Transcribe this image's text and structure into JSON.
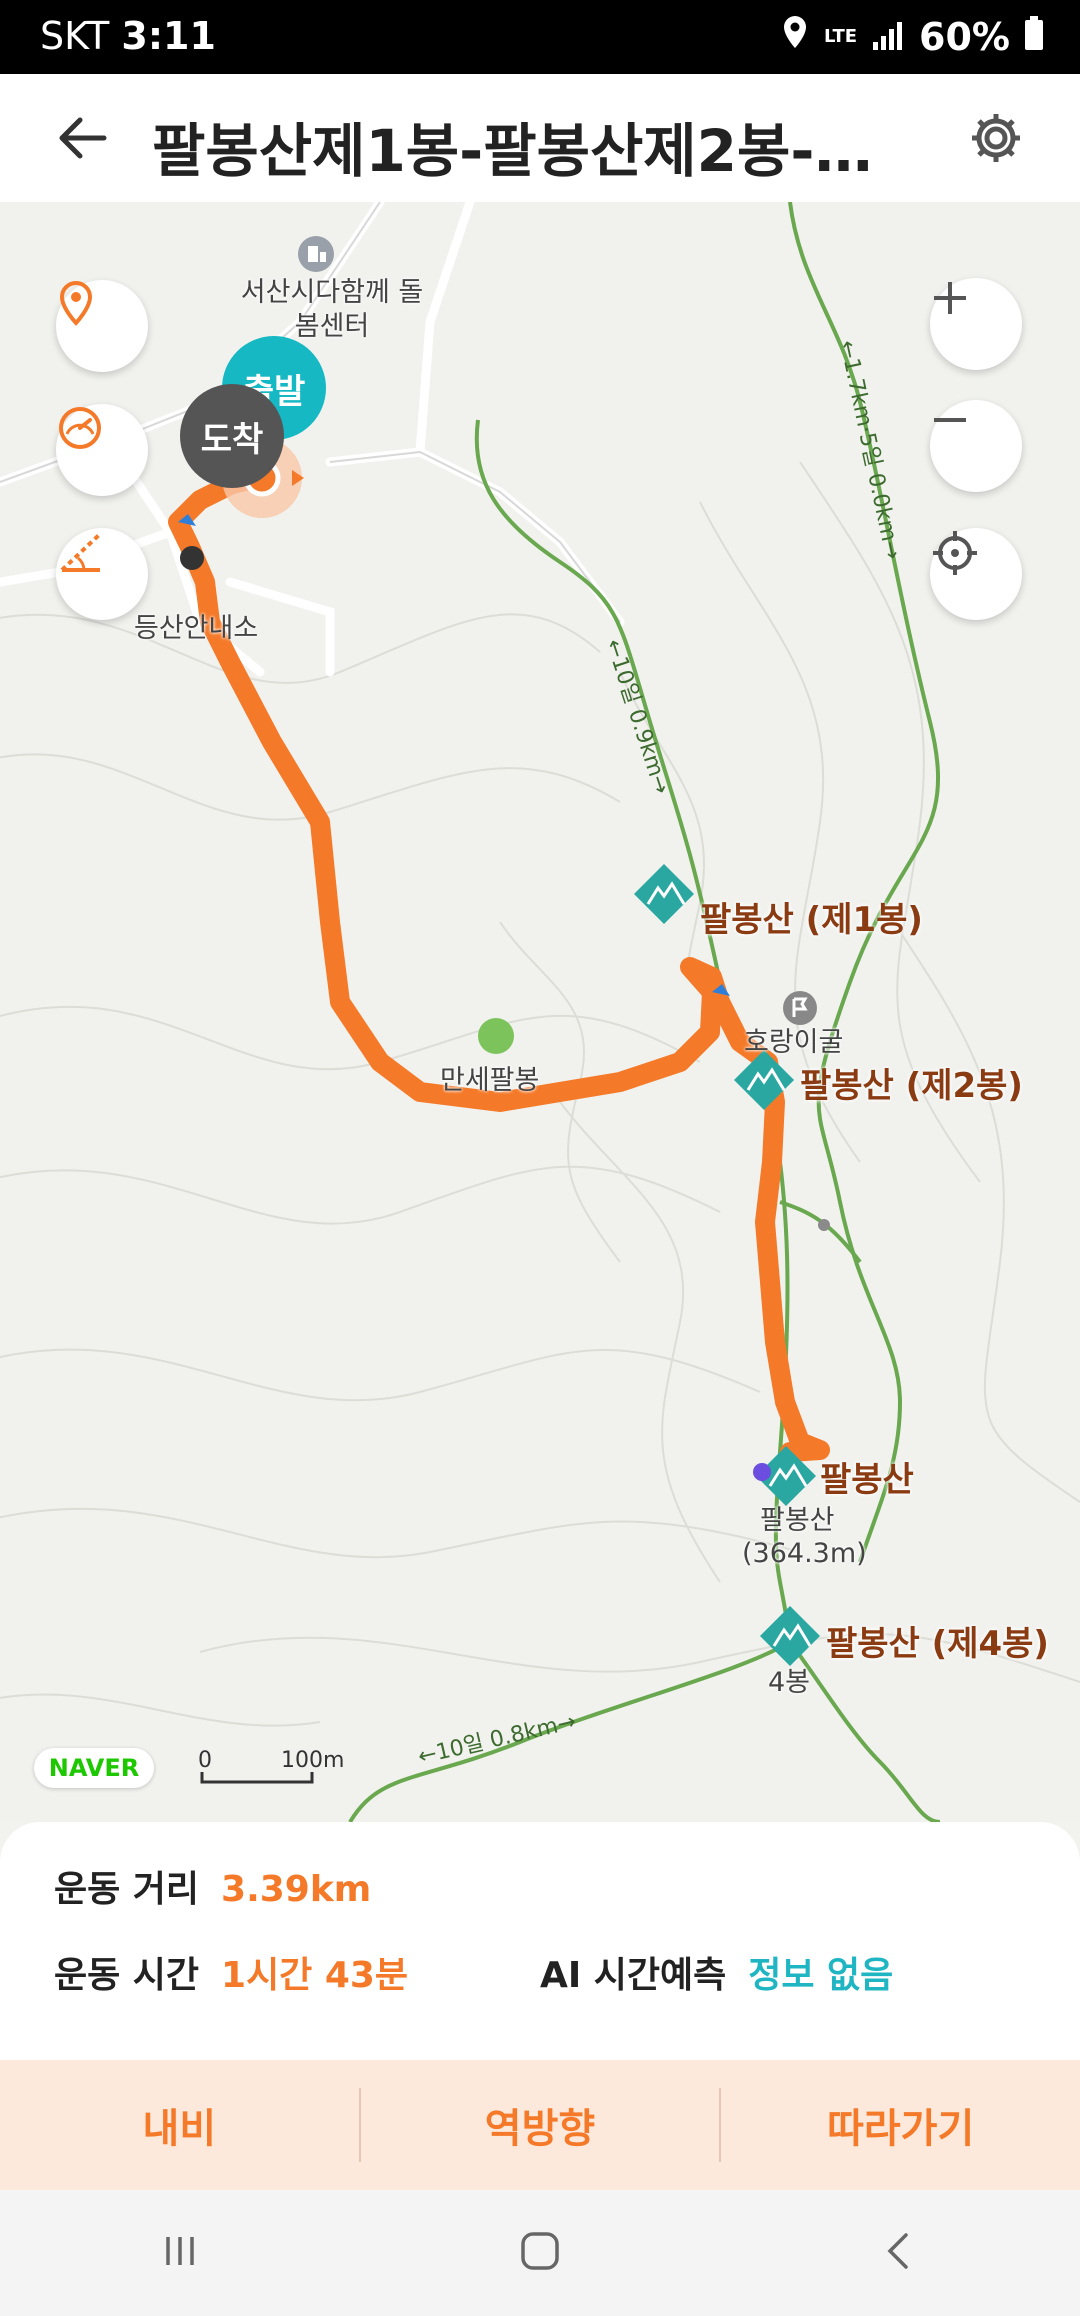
{
  "status_bar": {
    "carrier": "SKT",
    "time": "3:11",
    "network": "LTE",
    "battery": "60%"
  },
  "header": {
    "title": "팔봉산제1봉-팔봉산제2봉-팔..."
  },
  "map": {
    "labels": {
      "center": "서산시다함께 돌봄센터",
      "trailhead": "등산안내소",
      "peak1": "팔봉산 (제1봉)",
      "cave": "호랑이굴",
      "peak2": "팔봉산 (제2봉)",
      "manse": "만세팔봉",
      "main_peak": "팔봉산",
      "main_peak_alt": "팔봉산",
      "elevation": "(364.3m)",
      "peak4": "팔봉산 (제4봉)",
      "peak4_short": "4봉",
      "trail_a": "←1.7km·5일 0.0km→",
      "trail_b": "←10일 0.9km→",
      "trail_c": "←10일 0.8km→"
    },
    "start_label": "출발",
    "end_label": "도착",
    "naver_logo": "NAVER",
    "scale_zero": "0",
    "scale_label": "100m"
  },
  "stats": {
    "distance_label": "운동 거리",
    "distance_value": "3.39km",
    "time_label": "운동 시간",
    "time_value": "1시간 43분",
    "ai_label": "AI 시간예측",
    "ai_value": "정보 없음"
  },
  "actions": {
    "nav": "내비",
    "reverse": "역방향",
    "follow": "따라가기"
  },
  "colors": {
    "route": "#f47a2a",
    "teal": "#16b8c3",
    "trail": "#6aa84f"
  }
}
